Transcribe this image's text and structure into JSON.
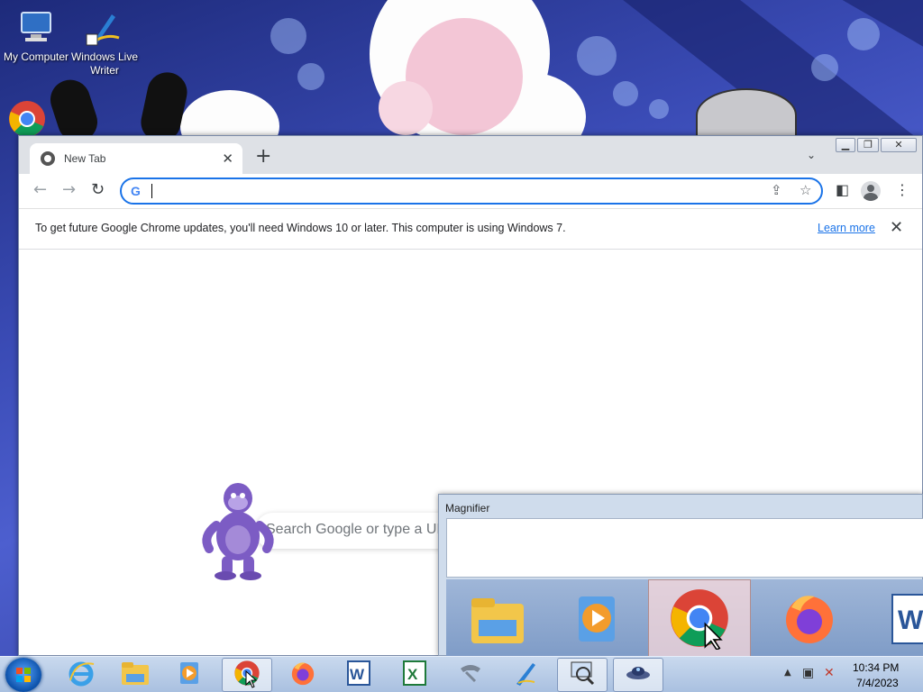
{
  "desktop": {
    "icons": [
      {
        "label": "My Computer",
        "icon": "computer-icon"
      },
      {
        "label": "Windows Live Writer",
        "icon": "writer-icon"
      }
    ]
  },
  "chrome": {
    "tab": {
      "title": "New Tab",
      "close": "✕"
    },
    "new_tab": "+",
    "tab_search": "⌄",
    "window_buttons": {
      "minimize": "▁",
      "restore": "❐",
      "close": "✕"
    },
    "nav": {
      "back": "←",
      "forward": "→",
      "reload": "↻"
    },
    "omnibox": {
      "value": "",
      "g_logo": "G"
    },
    "infobar": {
      "message": "To get future Google Chrome updates, you'll need Windows 10 or later. This computer is using Windows 7.",
      "link": "Learn more",
      "close": "✕"
    },
    "ntp": {
      "search_placeholder": "Search Google or type a URL"
    }
  },
  "magnifier": {
    "title": "Magnifier"
  },
  "taskbar": {
    "items": [
      "Internet Explorer",
      "Windows Explorer",
      "Windows Media Player",
      "Google Chrome",
      "Firefox",
      "Word",
      "Excel",
      "Phone",
      "Paint",
      "Magnifier",
      "BonziBuddy"
    ],
    "clock": {
      "time": "10:34 PM",
      "date": "7/4/2023"
    }
  },
  "colors": {
    "accent": "#1a73e8",
    "titlebar": "#dee1e6",
    "taskbar": "#b8cce8"
  }
}
